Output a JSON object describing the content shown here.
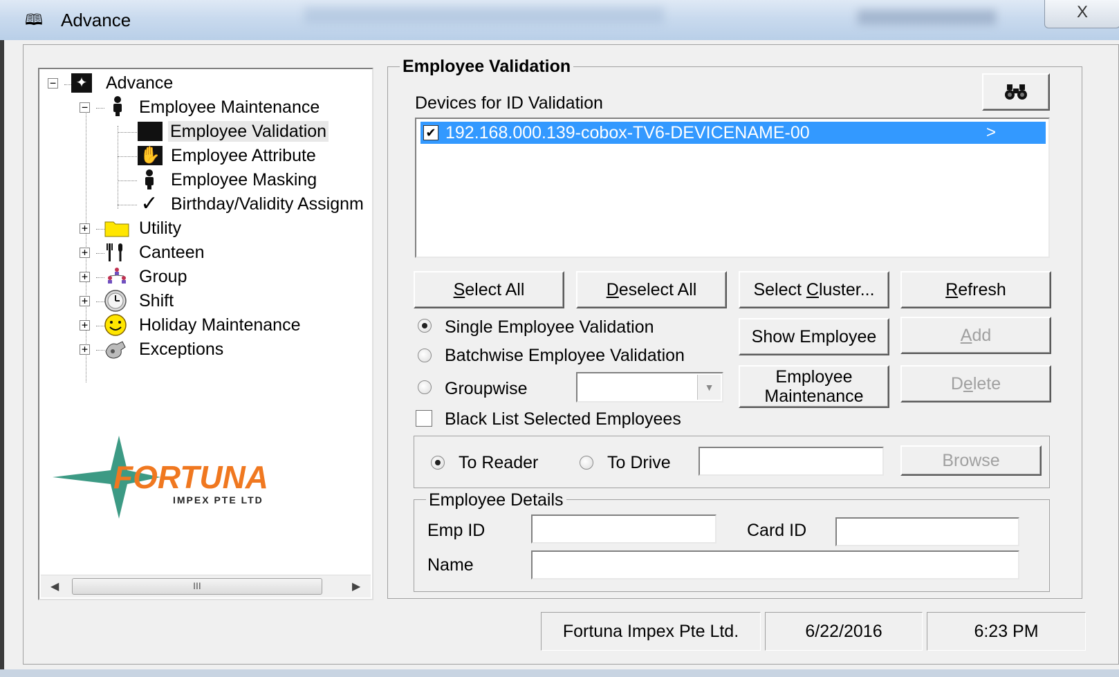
{
  "window": {
    "title": "Advance",
    "close_glyph": "X"
  },
  "tree": {
    "root": "Advance",
    "employee_maintenance": "Employee Maintenance",
    "employee_validation": "Employee Validation",
    "employee_attribute": "Employee Attribute",
    "employee_masking": "Employee Masking",
    "birthday_validity": "Birthday/Validity Assignm",
    "utility": "Utility",
    "canteen": "Canteen",
    "group": "Group",
    "shift": "Shift",
    "holiday": "Holiday Maintenance",
    "exceptions": "Exceptions",
    "scroll_grip": "III"
  },
  "logo": {
    "name": "FORTUNA",
    "subtitle": "IMPEX PTE LTD",
    "star_color": "#3c9a84",
    "text_color": "#f07820"
  },
  "validation": {
    "group_title": "Employee Validation",
    "devices_label": "Devices for ID Validation",
    "device_items": [
      {
        "label": "192.168.000.139-cobox-TV6-DEVICENAME-00",
        "checked": true,
        "suffix": ">"
      }
    ],
    "buttons": {
      "select_all_u": "S",
      "select_all_rest": "elect All",
      "deselect_all_u": "D",
      "deselect_all_rest": "eselect All",
      "select_cluster_pre": "Select ",
      "select_cluster_u": "C",
      "select_cluster_rest": "luster...",
      "refresh_u": "R",
      "refresh_rest": "efresh",
      "show_employee": "Show Employee",
      "add_u": "A",
      "add_rest": "dd",
      "employee_maint_line1": "Employee",
      "employee_maint_line2": "Maintenance",
      "delete_pre": "D",
      "delete_u": "e",
      "delete_rest": "lete",
      "browse": "Browse"
    },
    "modes": {
      "single": "Single Employee Validation",
      "batchwise": "Batchwise Employee Validation",
      "groupwise": "Groupwise",
      "selected": "single"
    },
    "blacklist_label": "Black List Selected Employees",
    "blacklist_checked": false,
    "target": {
      "to_reader": "To Reader",
      "to_drive": "To Drive",
      "selected": "to_reader",
      "drive_value": ""
    },
    "details": {
      "title": "Employee Details",
      "emp_id_label": "Emp ID",
      "card_id_label": "Card ID",
      "name_label": "Name",
      "emp_id_value": "",
      "card_id_value": "",
      "name_value": ""
    }
  },
  "statusbar": {
    "company": "Fortuna Impex Pte Ltd.",
    "date": "6/22/2016",
    "time": "6:23 PM"
  },
  "colors": {
    "selection": "#3399ff",
    "face": "#f0f0f0"
  }
}
